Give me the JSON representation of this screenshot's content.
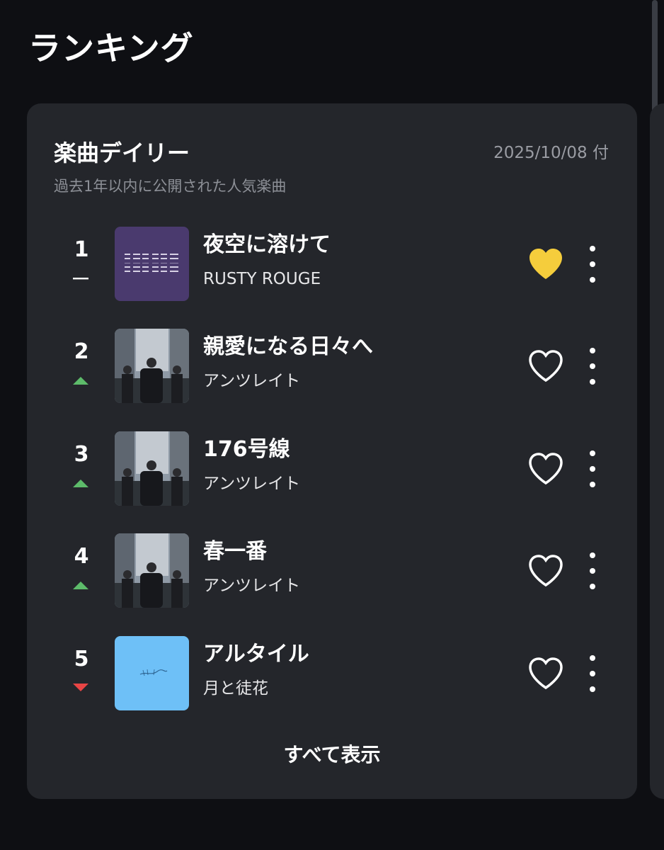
{
  "page": {
    "title": "ランキング"
  },
  "card": {
    "title": "楽曲デイリー",
    "date": "2025/10/08 付",
    "subtitle": "過去1年以内に公開された人気楽曲",
    "show_all_label": "すべて表示"
  },
  "songs": [
    {
      "rank": "1",
      "trend": "same",
      "title": "夜空に溶けて",
      "artist": "RUSTY ROUGE",
      "liked": true,
      "art": "purple-pattern"
    },
    {
      "rank": "2",
      "trend": "up",
      "title": "親愛になる日々へ",
      "artist": "アンツレイト",
      "liked": false,
      "art": "street-photo"
    },
    {
      "rank": "3",
      "trend": "up",
      "title": "176号線",
      "artist": "アンツレイト",
      "liked": false,
      "art": "street-photo"
    },
    {
      "rank": "4",
      "trend": "up",
      "title": "春一番",
      "artist": "アンツレイト",
      "liked": false,
      "art": "street-photo"
    },
    {
      "rank": "5",
      "trend": "down",
      "title": "アルタイル",
      "artist": "月と徒花",
      "liked": false,
      "art": "light-blue"
    }
  ],
  "icons": {
    "heart_filled": "heart-filled-icon",
    "heart_outline": "heart-outline-icon",
    "more": "more-vertical-icon",
    "trend_up": "trend-up-icon",
    "trend_down": "trend-down-icon",
    "trend_same": "trend-same-icon"
  },
  "colors": {
    "background": "#0e0f13",
    "card": "#24262b",
    "heart_filled": "#f5cd3c",
    "trend_up": "#5dbb6a",
    "trend_down": "#e84545",
    "muted_text": "#9a9ca3"
  }
}
